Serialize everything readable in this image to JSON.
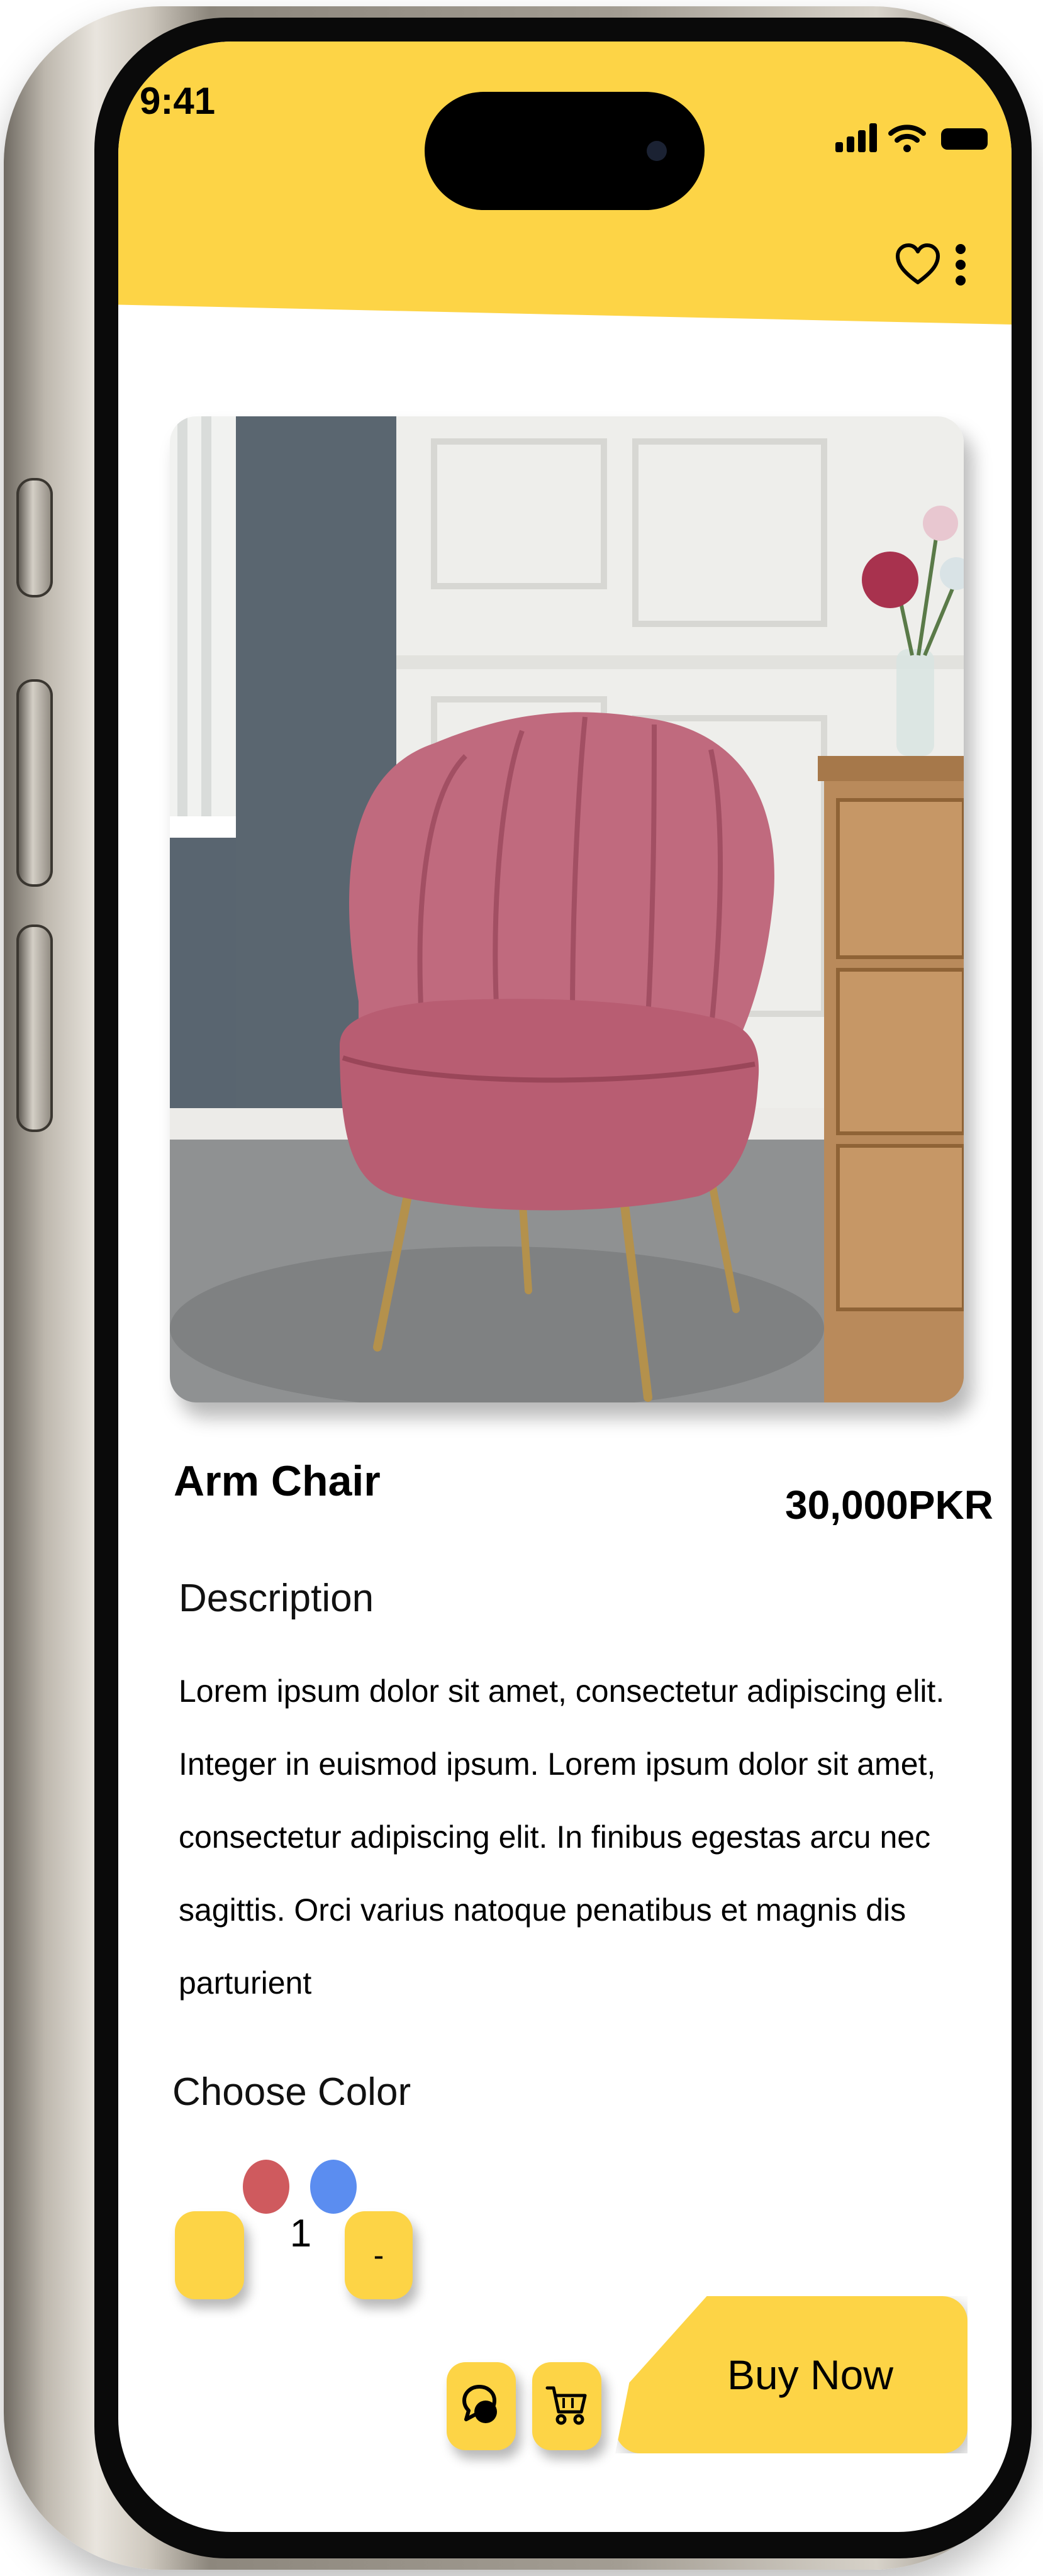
{
  "status_bar": {
    "time": "9:41"
  },
  "icons": {
    "signal": "cellular-signal-icon",
    "wifi": "wifi-icon",
    "battery": "battery-icon",
    "favorite": "heart-icon",
    "menu": "more-vertical-icon",
    "chat": "chat-icon",
    "cart": "cart-icon"
  },
  "colors": {
    "accent": "#fdd446",
    "swatch_red": "#cf5a5e",
    "swatch_blue": "#5b8df0"
  },
  "product": {
    "image_alt": "pink velvet arm chair",
    "title": "Arm Chair",
    "price": "30,000PKR",
    "description_heading": "Description",
    "description_lines": [
      "Lorem ipsum dolor sit amet, consectetur adipiscing elit.",
      "Integer in euismod ipsum. Lorem ipsum dolor sit amet,",
      "consectetur adipiscing elit. In finibus egestas arcu nec",
      "sagittis. Orci varius natoque penatibus et magnis dis",
      "parturient"
    ],
    "choose_color_heading": "Choose Color"
  },
  "quantity": {
    "increase_label": "",
    "value": "1",
    "decrease_label": "-"
  },
  "actions": {
    "buy_now_label": "Buy Now"
  }
}
